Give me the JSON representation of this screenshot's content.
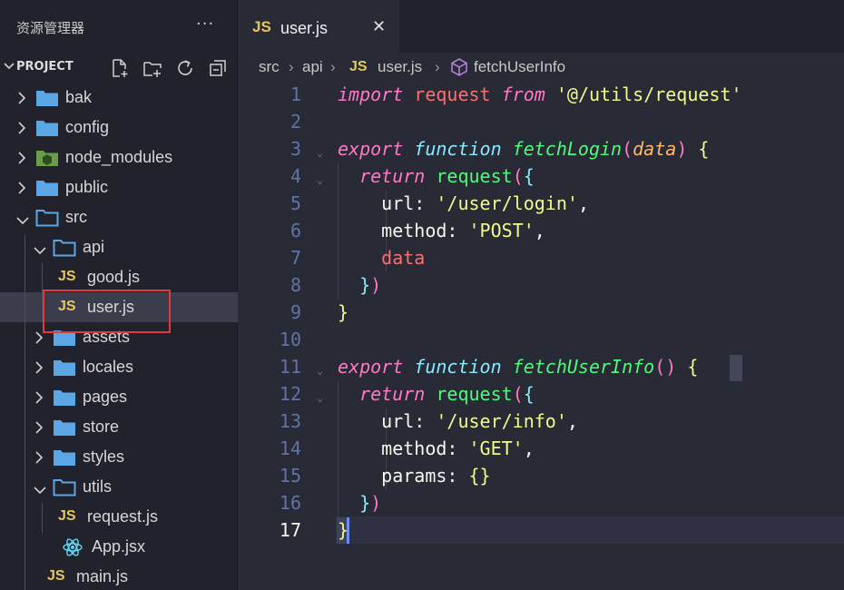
{
  "sidebar": {
    "title": "资源管理器",
    "more": "···",
    "project_label": "PROJECT",
    "tree": [
      {
        "label": "bak",
        "type": "folder",
        "depth": 0,
        "expanded": false
      },
      {
        "label": "config",
        "type": "folder",
        "depth": 0,
        "expanded": false
      },
      {
        "label": "node_modules",
        "type": "folder-node",
        "depth": 0,
        "expanded": false
      },
      {
        "label": "public",
        "type": "folder",
        "depth": 0,
        "expanded": false
      },
      {
        "label": "src",
        "type": "folder-open",
        "depth": 0,
        "expanded": true
      },
      {
        "label": "api",
        "type": "folder-open",
        "depth": 1,
        "expanded": true
      },
      {
        "label": "good.js",
        "type": "js",
        "depth": 2
      },
      {
        "label": "user.js",
        "type": "js",
        "depth": 2,
        "active": true
      },
      {
        "label": "assets",
        "type": "folder",
        "depth": 1,
        "expanded": false
      },
      {
        "label": "locales",
        "type": "folder",
        "depth": 1,
        "expanded": false
      },
      {
        "label": "pages",
        "type": "folder",
        "depth": 1,
        "expanded": false
      },
      {
        "label": "store",
        "type": "folder",
        "depth": 1,
        "expanded": false
      },
      {
        "label": "styles",
        "type": "folder",
        "depth": 1,
        "expanded": false
      },
      {
        "label": "utils",
        "type": "folder-open",
        "depth": 1,
        "expanded": true
      },
      {
        "label": "request.js",
        "type": "js",
        "depth": 2
      },
      {
        "label": "App.jsx",
        "type": "react",
        "depth": 1
      },
      {
        "label": "main.js",
        "type": "js",
        "depth": 1
      }
    ],
    "js_badge": "JS"
  },
  "tab": {
    "badge": "JS",
    "title": "user.js",
    "close": "✕"
  },
  "breadcrumb": {
    "parts": [
      "src",
      "api",
      "user.js",
      "fetchUserInfo"
    ],
    "sep": "›",
    "badge": "JS"
  },
  "code": {
    "current_line": 17,
    "line_numbers": [
      "1",
      "2",
      "3",
      "4",
      "5",
      "6",
      "7",
      "8",
      "9",
      "10",
      "11",
      "12",
      "13",
      "14",
      "15",
      "16",
      "17"
    ]
  },
  "colors": {
    "background": "#282a36",
    "sidebar": "#21222c",
    "highlight_border": "#e23a3a",
    "js_badge": "#e6c760",
    "folder": "#5ba7e6"
  }
}
